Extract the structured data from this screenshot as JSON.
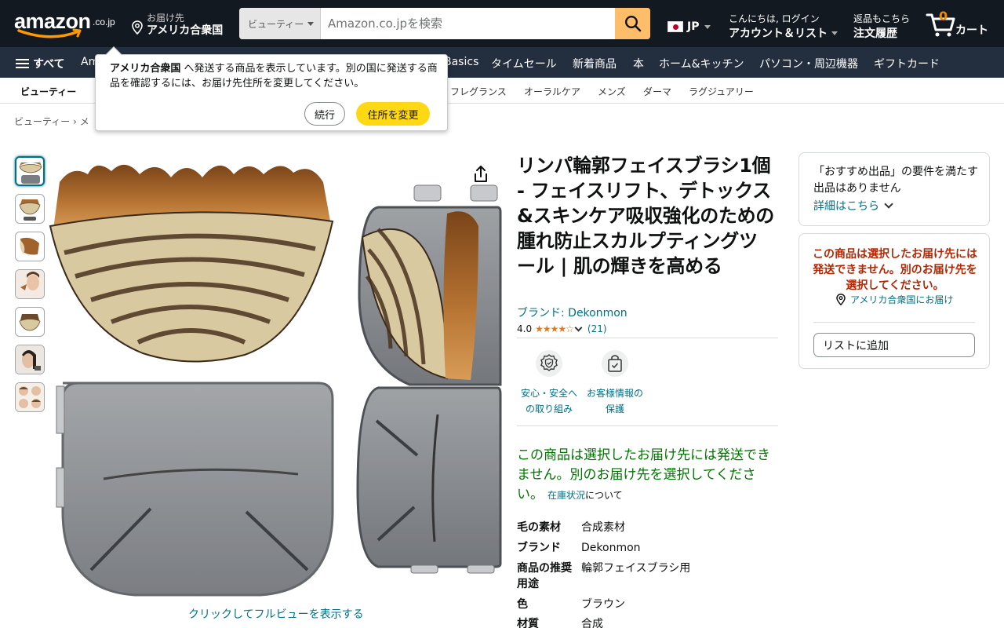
{
  "header": {
    "logo_text": "amazon",
    "logo_suffix": ".co.jp",
    "deliver_line1": "お届け先",
    "deliver_line2": "アメリカ合衆国",
    "search_category": "ビューティー",
    "search_placeholder": "Amazon.co.jpを検索",
    "language": "JP",
    "account_line1": "こんにちは, ログイン",
    "account_line2": "アカウント＆リスト",
    "orders_line1": "返品もこちら",
    "orders_line2": "注文履歴",
    "cart_count": "0",
    "cart_label": "カート"
  },
  "nav": {
    "all_label": "すべて",
    "items": [
      "Am",
      "Basics",
      "タイムセール",
      "新着商品",
      "本",
      "ホーム&キッチン",
      "パソコン・周辺機器",
      "ギフトカード"
    ]
  },
  "subnav": {
    "items": [
      "ビューティー",
      "フレグランス",
      "オーラルケア",
      "メンズ",
      "ダーマ",
      "ラグジュアリー"
    ]
  },
  "breadcrumb": "ビューティー › メ",
  "popover": {
    "bold": "アメリカ合衆国",
    "message": " へ発送する商品を表示しています。別の国に発送する商品を確認するには、お届け先住所を変更してください。",
    "continue_label": "続行",
    "change_label": "住所を変更"
  },
  "gallery": {
    "full_view_label": "クリックしてフルビューを表示する"
  },
  "product": {
    "title": "リンパ輪郭フェイスブラシ1個 - フェイスリフト、デトックス&スキンケア吸収強化のための腫れ防止スカルプティングツール | 肌の輝きを高める",
    "brand_label": "ブランド: Dekonmon",
    "rating_value": "4.0",
    "rating_stars": "★★★★☆",
    "rating_count": "(21)",
    "badges": [
      {
        "label": "安心・安全への取り組み",
        "icon": "shield-check-icon"
      },
      {
        "label": "お客様情報の保護",
        "icon": "secure-bag-icon"
      }
    ],
    "availability": "この商品は選択したお届け先には発送できません。別のお届け先を選択してください。",
    "stock_link": "在庫状況",
    "stock_suffix": "について",
    "specs": [
      {
        "key": "毛の素材",
        "value": "合成素材"
      },
      {
        "key": "ブランド",
        "value": "Dekonmon"
      },
      {
        "key": "商品の推奨用途",
        "value": "輪郭フェイスブラシ用"
      },
      {
        "key": "色",
        "value": "ブラウン"
      },
      {
        "key": "材質",
        "value": "合成"
      }
    ]
  },
  "buybox": {
    "no_offer_text": "「おすすめ出品」の要件を満たす出品はありません",
    "details_link": "詳細はこちら",
    "warning": "この商品は選択したお届け先には発送できません。別のお届け先を選択してください。",
    "ship_to": "アメリカ合衆国にお届け",
    "add_to_list": "リストに追加"
  },
  "colors": {
    "header_bg": "#131921",
    "nav_bg": "#232f3e",
    "search_button": "#febd69",
    "primary_button": "#ffd814",
    "link": "#007185",
    "success": "#007600",
    "error": "#b12704",
    "star": "#de7921",
    "cart_count": "#f08804"
  }
}
